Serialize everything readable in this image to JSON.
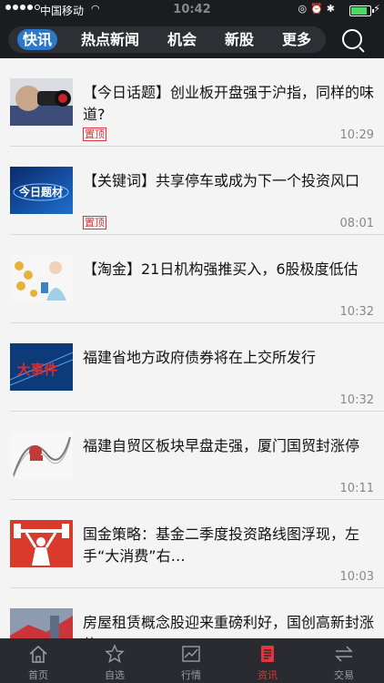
{
  "status": {
    "carrier": "中国移动",
    "time": "10:42"
  },
  "top_tabs": [
    "快讯",
    "热点新闻",
    "机会",
    "新股",
    "更多"
  ],
  "news": [
    {
      "title": "【今日话题】创业板开盘强于沪指，同样的味道?",
      "badge": "置顶",
      "time": "10:29"
    },
    {
      "title": "【关键词】共享停车或成为下一个投资风口",
      "badge": "置顶",
      "time": "08:01",
      "thumb_text": "今日题材"
    },
    {
      "title": "【淘金】21日机构强推买入，6股极度低估",
      "time": "10:32"
    },
    {
      "title": "福建省地方政府债券将在上交所发行",
      "time": "10:32",
      "thumb_text": "大事件"
    },
    {
      "title": "福建自贸区板块早盘走强，厦门国贸封涨停",
      "time": "10:11"
    },
    {
      "title": "国金策略：基金二季度投资路线图浮现，左手“大消费”右…",
      "time": "10:03"
    },
    {
      "title": "房屋租赁概念股迎来重磅利好，国创高新封涨停",
      "time": ""
    }
  ],
  "bottom_tabs": [
    {
      "label": "首页",
      "icon": "home-icon"
    },
    {
      "label": "自选",
      "icon": "star-icon"
    },
    {
      "label": "行情",
      "icon": "chart-icon"
    },
    {
      "label": "资讯",
      "icon": "news-icon"
    },
    {
      "label": "交易",
      "icon": "exchange-icon"
    }
  ],
  "colors": {
    "accent_blue": "#2b79c9",
    "accent_red": "#e0353f",
    "dark": "#1b1c20"
  }
}
